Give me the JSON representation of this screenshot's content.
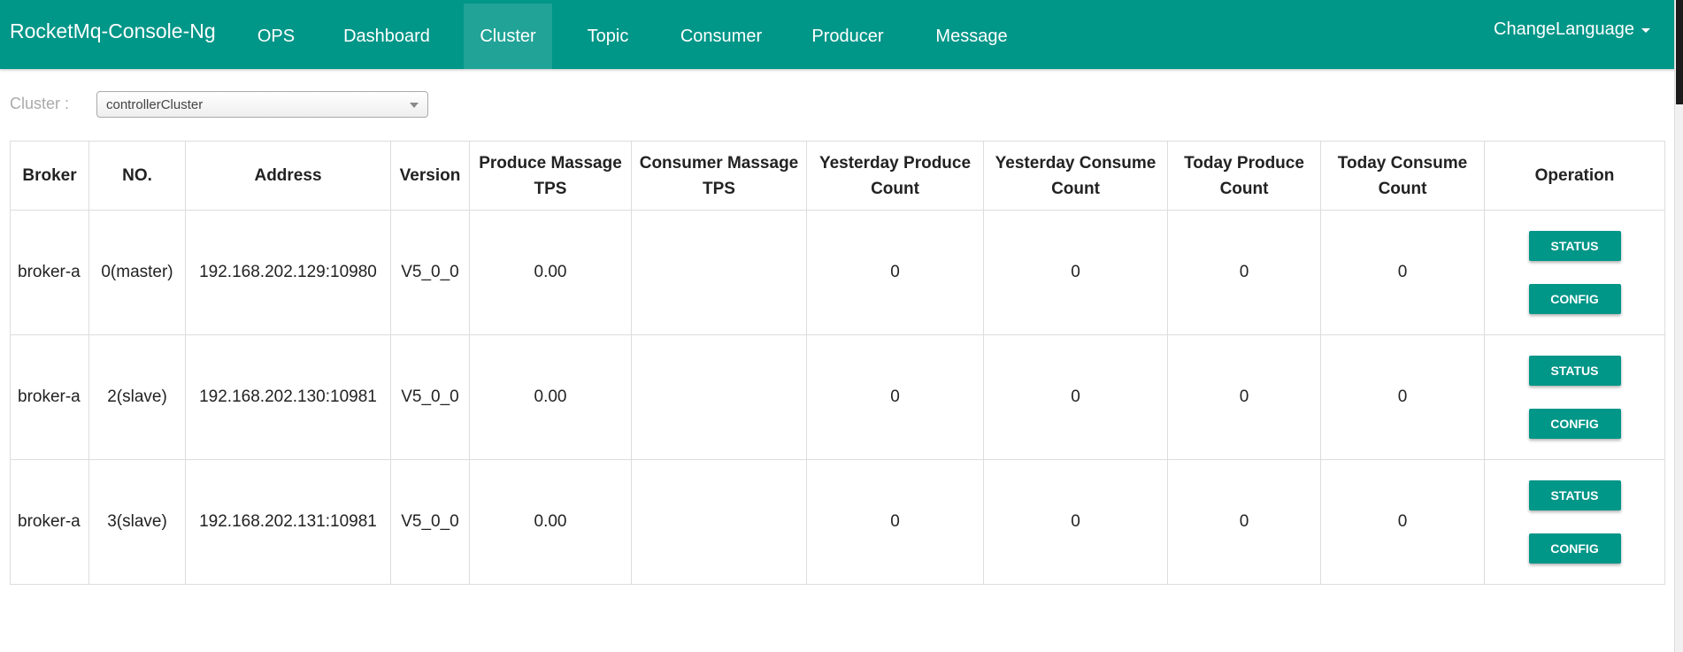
{
  "navbar": {
    "brand": "RocketMq-Console-Ng",
    "items": [
      {
        "label": "OPS"
      },
      {
        "label": "Dashboard"
      },
      {
        "label": "Cluster"
      },
      {
        "label": "Topic"
      },
      {
        "label": "Consumer"
      },
      {
        "label": "Producer"
      },
      {
        "label": "Message"
      }
    ],
    "active": "Cluster",
    "language": "ChangeLanguage",
    "background_color": "#009688"
  },
  "filter": {
    "label": "Cluster :",
    "selected": "controllerCluster"
  },
  "table": {
    "headers": [
      "Broker",
      "NO.",
      "Address",
      "Version",
      "Produce Massage TPS",
      "Consumer Massage TPS",
      "Yesterday Produce Count",
      "Yesterday Consume Count",
      "Today Produce Count",
      "Today Consume Count",
      "Operation"
    ],
    "rows": [
      {
        "broker": "broker-a",
        "no": "0(master)",
        "address": "192.168.202.129:10980",
        "version": "V5_0_0",
        "produce_tps": "0.00",
        "consume_tps": "",
        "yesterday_produce": "0",
        "yesterday_consume": "0",
        "today_produce": "0",
        "today_consume": "0"
      },
      {
        "broker": "broker-a",
        "no": "2(slave)",
        "address": "192.168.202.130:10981",
        "version": "V5_0_0",
        "produce_tps": "0.00",
        "consume_tps": "",
        "yesterday_produce": "0",
        "yesterday_consume": "0",
        "today_produce": "0",
        "today_consume": "0"
      },
      {
        "broker": "broker-a",
        "no": "3(slave)",
        "address": "192.168.202.131:10981",
        "version": "V5_0_0",
        "produce_tps": "0.00",
        "consume_tps": "",
        "yesterday_produce": "0",
        "yesterday_consume": "0",
        "today_produce": "0",
        "today_consume": "0"
      }
    ],
    "status_button": "STATUS",
    "config_button": "CONFIG",
    "button_color": "#009688"
  }
}
